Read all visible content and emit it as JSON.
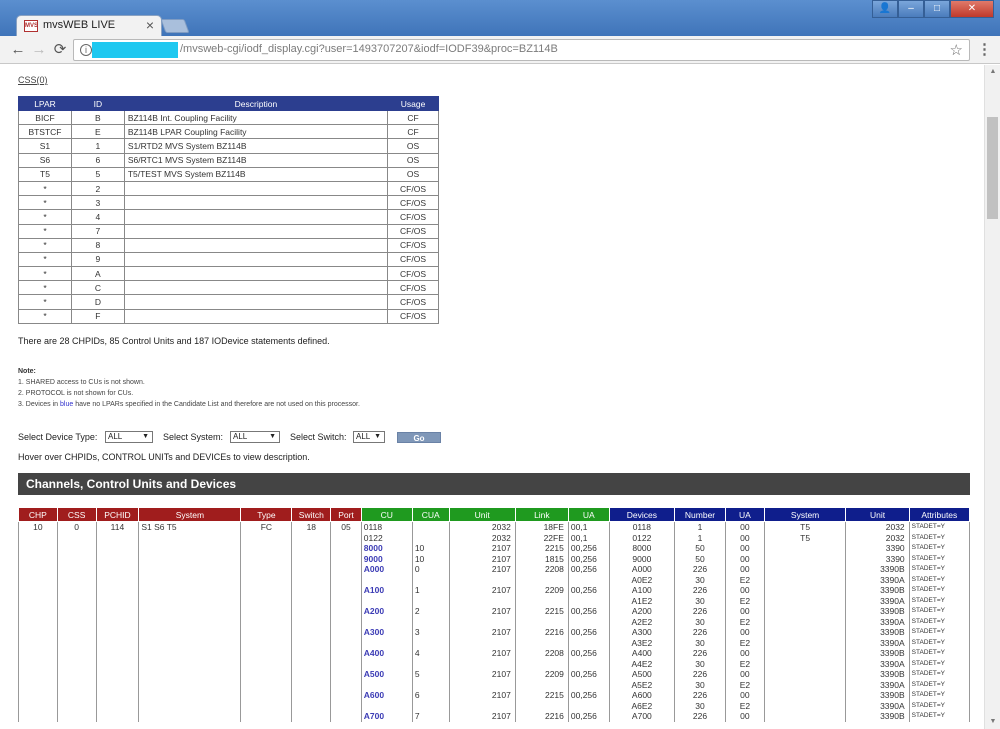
{
  "browser": {
    "tab_title": "mvsWEB LIVE",
    "tab_icon_text": "MVS",
    "url": "/mvsweb-cgi/iodf_display.cgi?user=1493707207&iodf=IODF39&proc=BZ114B",
    "close_glyph": "×",
    "back_glyph": "←",
    "forward_glyph": "→",
    "reload_glyph": "⟳",
    "star_glyph": "☆",
    "menu_glyph": "⋮",
    "window_minimize": "–",
    "window_maximize": "□",
    "window_close": "✕",
    "window_user": "👤"
  },
  "css_link": "CSS(0)",
  "lpar_table": {
    "headers": [
      "LPAR",
      "ID",
      "Description",
      "Usage"
    ],
    "rows": [
      [
        "BICF",
        "B",
        "BZ114B Int. Coupling Facility",
        "CF"
      ],
      [
        "BTSTCF",
        "E",
        "BZ114B LPAR Coupling Facility",
        "CF"
      ],
      [
        "S1",
        "1",
        "S1/RTD2 MVS System BZ114B",
        "OS"
      ],
      [
        "S6",
        "6",
        "S6/RTC1 MVS System BZ114B",
        "OS"
      ],
      [
        "T5",
        "5",
        "T5/TEST MVS System BZ114B",
        "OS"
      ],
      [
        "*",
        "2",
        "",
        "CF/OS"
      ],
      [
        "*",
        "3",
        "",
        "CF/OS"
      ],
      [
        "*",
        "4",
        "",
        "CF/OS"
      ],
      [
        "*",
        "7",
        "",
        "CF/OS"
      ],
      [
        "*",
        "8",
        "",
        "CF/OS"
      ],
      [
        "*",
        "9",
        "",
        "CF/OS"
      ],
      [
        "*",
        "A",
        "",
        "CF/OS"
      ],
      [
        "*",
        "C",
        "",
        "CF/OS"
      ],
      [
        "*",
        "D",
        "",
        "CF/OS"
      ],
      [
        "*",
        "F",
        "",
        "CF/OS"
      ]
    ]
  },
  "summary": "There are 28 CHPIDs, 85 Control Units and 187 IODevice statements defined.",
  "notes": {
    "title": "Note:",
    "line1": "1. SHARED access to CUs is not shown.",
    "line2": "2. PROTOCOL is not shown for CUs.",
    "line3_pre": "3. Devices in ",
    "line3_blue": "blue",
    "line3_post": " have no LPARs specified in the Candidate List and therefore are not used on this processor."
  },
  "filters": {
    "device_type_label": "Select Device Type:",
    "device_type_value": "ALL",
    "system_label": "Select System:",
    "system_value": "ALL",
    "switch_label": "Select Switch:",
    "switch_value": "ALL",
    "go_label": "Go",
    "arrow": "▼"
  },
  "hover_hint": "Hover over CHPIDs, CONTROL UNITs and DEVICEs to view description.",
  "section_title": "Channels, Control Units and Devices",
  "channel_table": {
    "headers": [
      "CHP",
      "CSS",
      "PCHID",
      "System",
      "Type",
      "Switch",
      "Port",
      "CU",
      "CUA",
      "Unit",
      "Link",
      "UA",
      "Devices",
      "Number",
      "UA",
      "System",
      "Unit",
      "Attributes"
    ],
    "header_colors": [
      "red",
      "red",
      "red",
      "red",
      "red",
      "red",
      "red",
      "green",
      "green",
      "green",
      "green",
      "green",
      "navy",
      "navy",
      "navy",
      "navy",
      "navy",
      "navy"
    ],
    "chp": "10",
    "css": "0",
    "pchid": "114",
    "system": "S1 S6 T5",
    "type": "FC",
    "switch": "18",
    "port": "05",
    "cu_rows": [
      {
        "cu": "0118",
        "cua": "",
        "unit": "2032",
        "link": "18FE",
        "ua": "00,1",
        "blue": false,
        "span": 1
      },
      {
        "cu": "0122",
        "cua": "",
        "unit": "2032",
        "link": "22FE",
        "ua": "00,1",
        "blue": false,
        "span": 1
      },
      {
        "cu": "8000",
        "cua": "10",
        "unit": "2107",
        "link": "2215",
        "ua": "00,256",
        "blue": true,
        "span": 1
      },
      {
        "cu": "9000",
        "cua": "10",
        "unit": "2107",
        "link": "1815",
        "ua": "00,256",
        "blue": true,
        "span": 1
      },
      {
        "cu": "A000",
        "cua": "0",
        "unit": "2107",
        "link": "2208",
        "ua": "00,256",
        "blue": true,
        "span": 2
      },
      {
        "cu": "A100",
        "cua": "1",
        "unit": "2107",
        "link": "2209",
        "ua": "00,256",
        "blue": true,
        "span": 2
      },
      {
        "cu": "A200",
        "cua": "2",
        "unit": "2107",
        "link": "2215",
        "ua": "00,256",
        "blue": true,
        "span": 2
      },
      {
        "cu": "A300",
        "cua": "3",
        "unit": "2107",
        "link": "2216",
        "ua": "00,256",
        "blue": true,
        "span": 2
      },
      {
        "cu": "A400",
        "cua": "4",
        "unit": "2107",
        "link": "2208",
        "ua": "00,256",
        "blue": true,
        "span": 2
      },
      {
        "cu": "A500",
        "cua": "5",
        "unit": "2107",
        "link": "2209",
        "ua": "00,256",
        "blue": true,
        "span": 2
      },
      {
        "cu": "A600",
        "cua": "6",
        "unit": "2107",
        "link": "2215",
        "ua": "00,256",
        "blue": true,
        "span": 2
      },
      {
        "cu": "A700",
        "cua": "7",
        "unit": "2107",
        "link": "2216",
        "ua": "00,256",
        "blue": true,
        "span": 1
      }
    ],
    "device_rows": [
      {
        "device": "0118",
        "number": "1",
        "ua": "00",
        "system": "T5",
        "unit": "2032",
        "attr": "STADET=Y"
      },
      {
        "device": "0122",
        "number": "1",
        "ua": "00",
        "system": "T5",
        "unit": "2032",
        "attr": "STADET=Y"
      },
      {
        "device": "8000",
        "number": "50",
        "ua": "00",
        "system": "",
        "unit": "3390",
        "attr": "STADET=Y"
      },
      {
        "device": "9000",
        "number": "50",
        "ua": "00",
        "system": "",
        "unit": "3390",
        "attr": "STADET=Y"
      },
      {
        "device": "A000",
        "number": "226",
        "ua": "00",
        "system": "",
        "unit": "3390B",
        "attr": "STADET=Y"
      },
      {
        "device": "A0E2",
        "number": "30",
        "ua": "E2",
        "system": "",
        "unit": "3390A",
        "attr": "STADET=Y"
      },
      {
        "device": "A100",
        "number": "226",
        "ua": "00",
        "system": "",
        "unit": "3390B",
        "attr": "STADET=Y"
      },
      {
        "device": "A1E2",
        "number": "30",
        "ua": "E2",
        "system": "",
        "unit": "3390A",
        "attr": "STADET=Y"
      },
      {
        "device": "A200",
        "number": "226",
        "ua": "00",
        "system": "",
        "unit": "3390B",
        "attr": "STADET=Y"
      },
      {
        "device": "A2E2",
        "number": "30",
        "ua": "E2",
        "system": "",
        "unit": "3390A",
        "attr": "STADET=Y"
      },
      {
        "device": "A300",
        "number": "226",
        "ua": "00",
        "system": "",
        "unit": "3390B",
        "attr": "STADET=Y"
      },
      {
        "device": "A3E2",
        "number": "30",
        "ua": "E2",
        "system": "",
        "unit": "3390A",
        "attr": "STADET=Y"
      },
      {
        "device": "A400",
        "number": "226",
        "ua": "00",
        "system": "",
        "unit": "3390B",
        "attr": "STADET=Y"
      },
      {
        "device": "A4E2",
        "number": "30",
        "ua": "E2",
        "system": "",
        "unit": "3390A",
        "attr": "STADET=Y"
      },
      {
        "device": "A500",
        "number": "226",
        "ua": "00",
        "system": "",
        "unit": "3390B",
        "attr": "STADET=Y"
      },
      {
        "device": "A5E2",
        "number": "30",
        "ua": "E2",
        "system": "",
        "unit": "3390A",
        "attr": "STADET=Y"
      },
      {
        "device": "A600",
        "number": "226",
        "ua": "00",
        "system": "",
        "unit": "3390B",
        "attr": "STADET=Y"
      },
      {
        "device": "A6E2",
        "number": "30",
        "ua": "E2",
        "system": "",
        "unit": "3390A",
        "attr": "STADET=Y"
      },
      {
        "device": "A700",
        "number": "226",
        "ua": "00",
        "system": "",
        "unit": "3390B",
        "attr": "STADET=Y"
      }
    ]
  },
  "colors": {
    "lpar_header": "#2c3e8f",
    "channel_header": "#a01d1d",
    "cu_header": "#1f9a1f",
    "device_header": "#0f1e8c",
    "section_bar": "#444444",
    "cu_blue_text": "#3b3bb5",
    "redaction": "#1fc8f0"
  }
}
